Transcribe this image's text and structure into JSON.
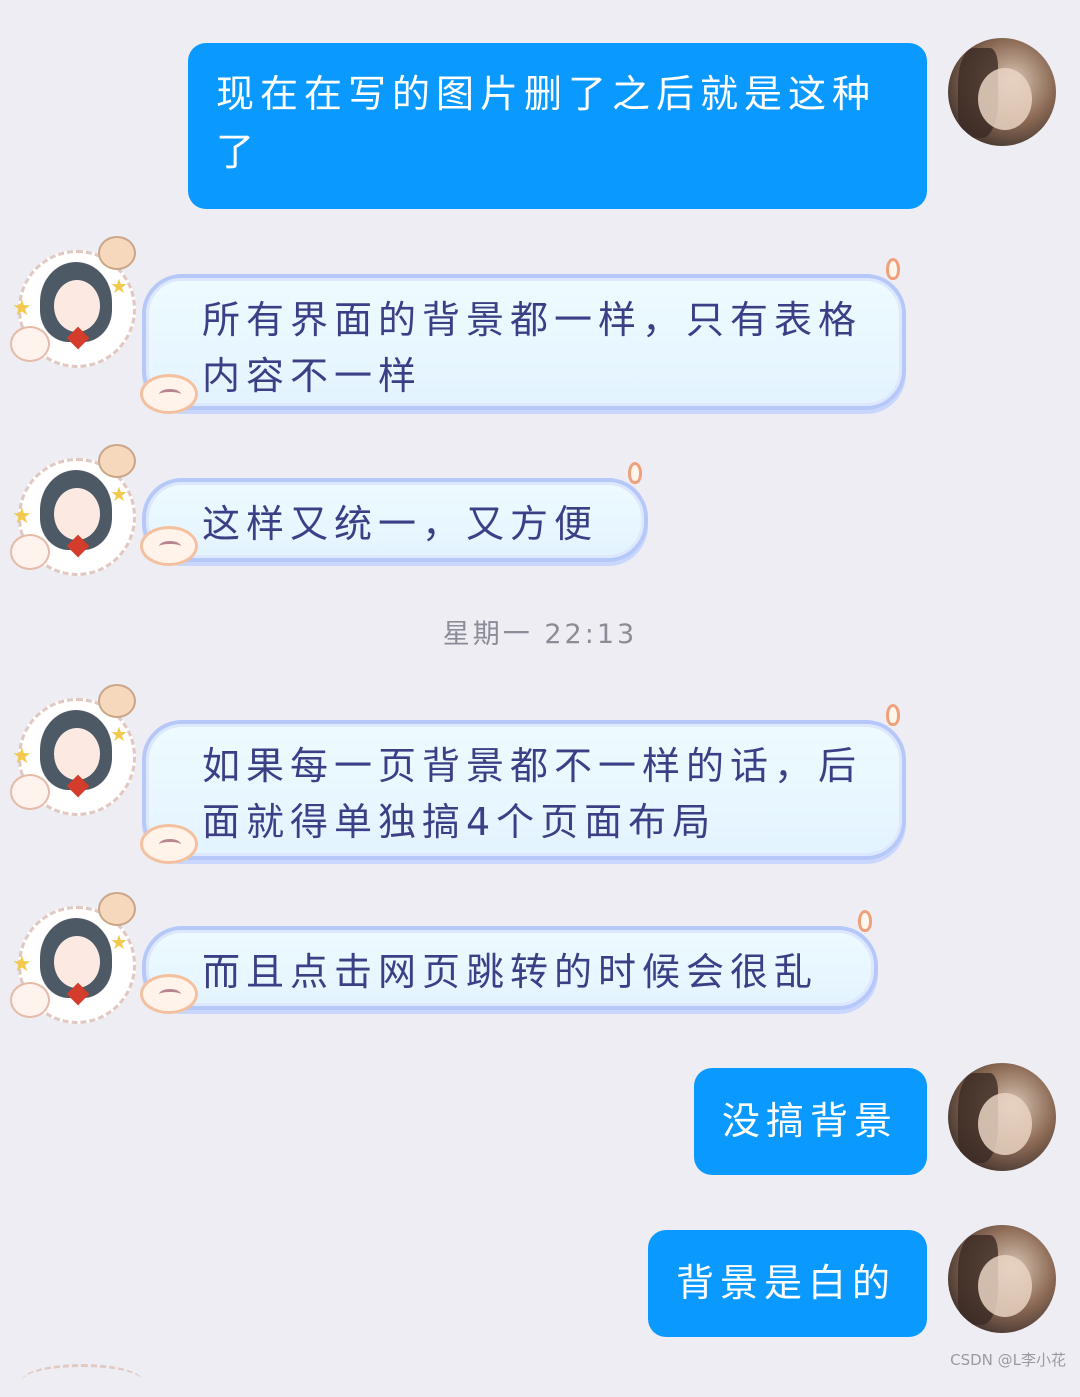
{
  "conversation": {
    "messages": [
      {
        "side": "out",
        "text": "现在在写的图片删了之后就是这种了"
      },
      {
        "side": "in",
        "text": "所有界面的背景都一样，只有表格内容不一样"
      },
      {
        "side": "in",
        "text": "这样又统一，又方便"
      },
      {
        "side": "in",
        "text": "如果每一页背景都不一样的话，后面就得单独搞4个页面布局"
      },
      {
        "side": "in",
        "text": "而且点击网页跳转的时候会很乱"
      },
      {
        "side": "out",
        "text": "没搞背景"
      },
      {
        "side": "out",
        "text": "背景是白的"
      }
    ],
    "timestamp": "星期一 22:13"
  },
  "watermark": "CSDN @L李小花",
  "colors": {
    "background": "#ededf3",
    "outgoing_bubble": "#0a99fe",
    "incoming_bubble": "#e8f7ff",
    "incoming_text": "#3c3f86",
    "timestamp_text": "#8c8c98"
  },
  "icons": {
    "outgoing_avatar": "user-photo-avatar",
    "incoming_avatar": "anime-girl-avatar"
  }
}
